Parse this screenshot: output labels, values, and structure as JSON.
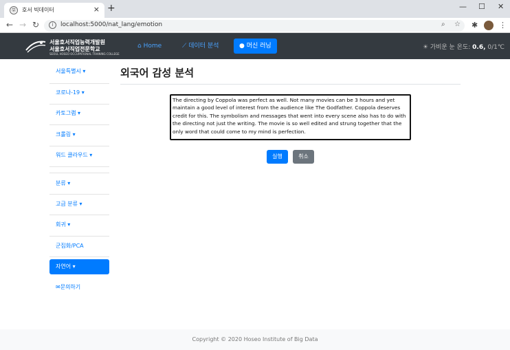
{
  "browser": {
    "tab_title": "호서 빅데이터",
    "url": "localhost:5000/nat_lang/emotion"
  },
  "navbar": {
    "logo_line1": "서울호서직업능력개발원",
    "logo_line2": "서울호서직업전문학교",
    "logo_line3": "SEOUL HOSEO OCCUPATIONAL TRAINING COLLEGE",
    "links": [
      {
        "label": "Home",
        "icon": "home-icon"
      },
      {
        "label": "데이터 분석",
        "icon": "chart-icon"
      },
      {
        "label": "머신 러닝",
        "icon": "brain-icon"
      }
    ],
    "temp_label": "가비운 눈 온도:",
    "temp_value": "0.6",
    "temp_unit": "0/1℃"
  },
  "sidebar": {
    "items": [
      "서울특별시 ▾",
      "코로나-19 ▾",
      "카토그램 ▾",
      "크롤링 ▾",
      "워드 클라우드 ▾",
      "분류 ▾",
      "고급 분류 ▾",
      "회귀 ▾",
      "군집화/PCA",
      "자연어 ▾",
      "문의하기"
    ],
    "active_index": 9
  },
  "main": {
    "title": "외국어 감성 분석",
    "textarea_value": "The directing by Coppola was perfect as well. Not many movies can be 3 hours and yet maintain a good level of interest from the audience like The Godfather. Coppola deserves credit for this. The symbolism and messages that went into every scene also has to do with the directing not just the writing. The movie is so well edited and strung together that the only word that could come to my mind is perfection.",
    "run_label": "실행",
    "cancel_label": "취소"
  },
  "footer": {
    "text": "Copyright © 2020 Hoseo Institute of Big Data"
  },
  "colors": {
    "primary": "#007bff",
    "navbar": "#343a40",
    "secondary": "#6c757d"
  }
}
